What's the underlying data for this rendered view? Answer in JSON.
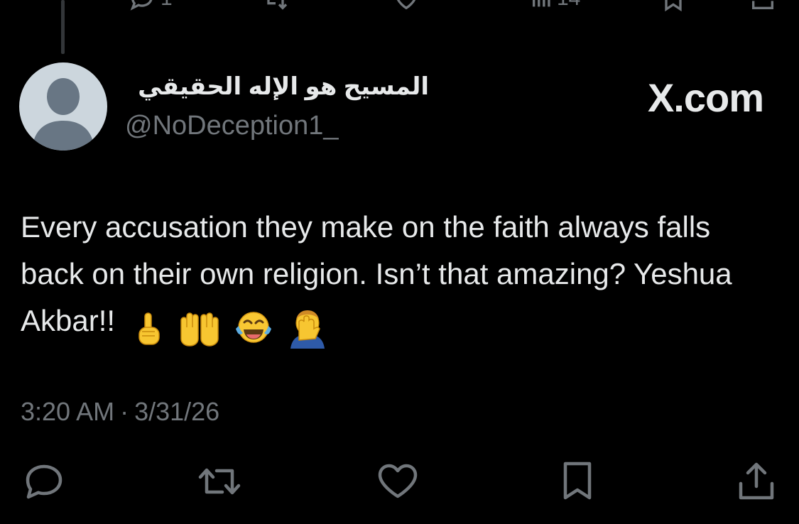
{
  "top_actions": {
    "reply_count": "1",
    "view_count": "14"
  },
  "post": {
    "display_name": "المسيح هو الإله الحقيقي",
    "handle": "@NoDeception1_",
    "watermark": "X.com",
    "text": "Every accusation they make on the faith always falls back on their own religion. Isn’t that amazing? Yeshua Akbar!!",
    "emojis": [
      "index-pointing-up",
      "raising-hands",
      "face-with-tears-of-joy",
      "man-facepalming"
    ],
    "time": "3:20 AM",
    "separator": "·",
    "date": "3/31/26"
  },
  "actions": [
    "reply-icon",
    "retweet-icon",
    "like-icon",
    "bookmark-icon",
    "share-icon"
  ],
  "colors": {
    "background": "#000000",
    "text": "#e7e9ea",
    "secondary": "#71767b",
    "avatar_bg": "#ccd6dd",
    "avatar_fg": "#687684"
  }
}
